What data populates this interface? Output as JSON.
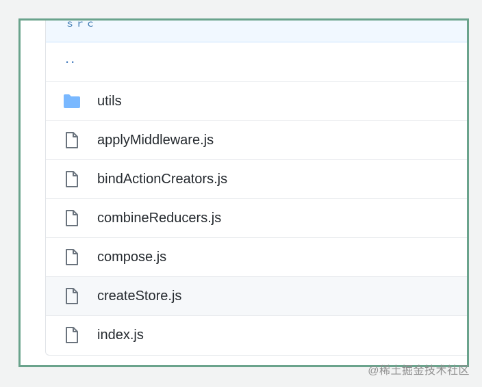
{
  "header": {
    "glyph": "ｓｒｃ"
  },
  "parent_dir": {
    "label": ".."
  },
  "files": [
    {
      "name": "utils",
      "icon": "folder-icon",
      "type": "folder"
    },
    {
      "name": "applyMiddleware.js",
      "icon": "file-icon",
      "type": "file"
    },
    {
      "name": "bindActionCreators.js",
      "icon": "file-icon",
      "type": "file"
    },
    {
      "name": "combineReducers.js",
      "icon": "file-icon",
      "type": "file"
    },
    {
      "name": "compose.js",
      "icon": "file-icon",
      "type": "file"
    },
    {
      "name": "createStore.js",
      "icon": "file-icon",
      "type": "file"
    },
    {
      "name": "index.js",
      "icon": "file-icon",
      "type": "file"
    }
  ],
  "colors": {
    "frame_border": "#6aa38c",
    "folder": "#79b8ff",
    "file_icon": "#6a737d",
    "text": "#24292e",
    "hover_row": "#f6f8fa"
  },
  "watermark": {
    "text": "@稀土掘金技术社区"
  }
}
